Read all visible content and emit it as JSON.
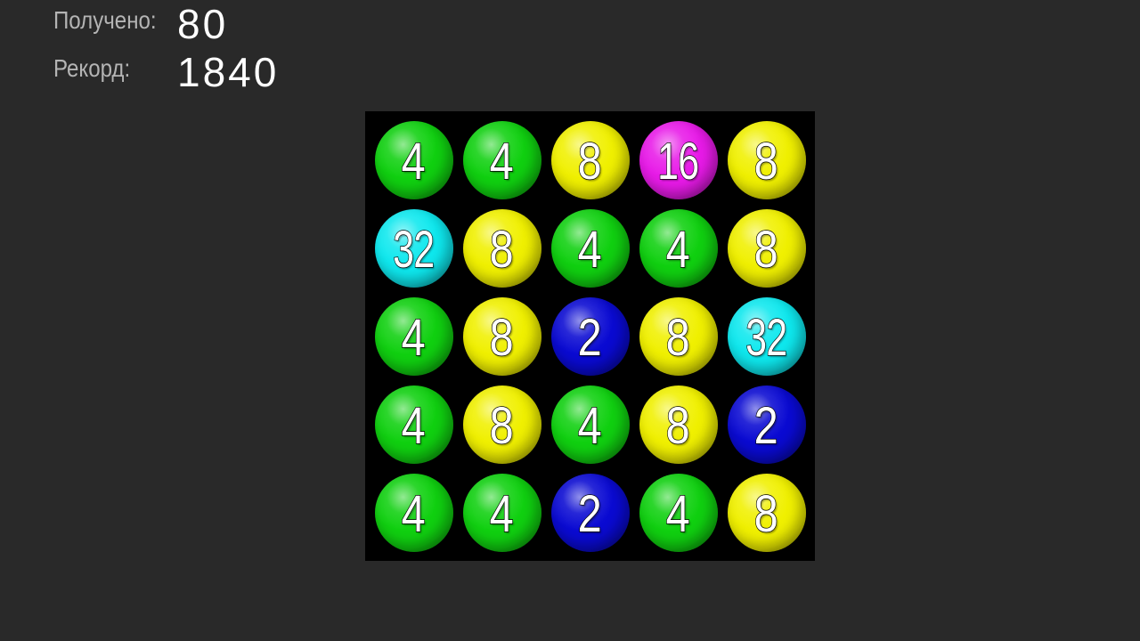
{
  "scoreboard": {
    "current_label": "Получено:",
    "current_value": "80",
    "record_label": "Рекорд:",
    "record_value": "1840"
  },
  "board": {
    "rows": [
      [
        "4",
        "4",
        "8",
        "16",
        "8"
      ],
      [
        "32",
        "8",
        "4",
        "4",
        "8"
      ],
      [
        "4",
        "8",
        "2",
        "8",
        "32"
      ],
      [
        "4",
        "8",
        "4",
        "8",
        "2"
      ],
      [
        "4",
        "4",
        "2",
        "4",
        "8"
      ]
    ]
  },
  "ball_colors": {
    "2": "#0a0ad2",
    "4": "#10d010",
    "8": "#f0f000",
    "16": "#e81ae8",
    "32": "#0ee8ee"
  }
}
